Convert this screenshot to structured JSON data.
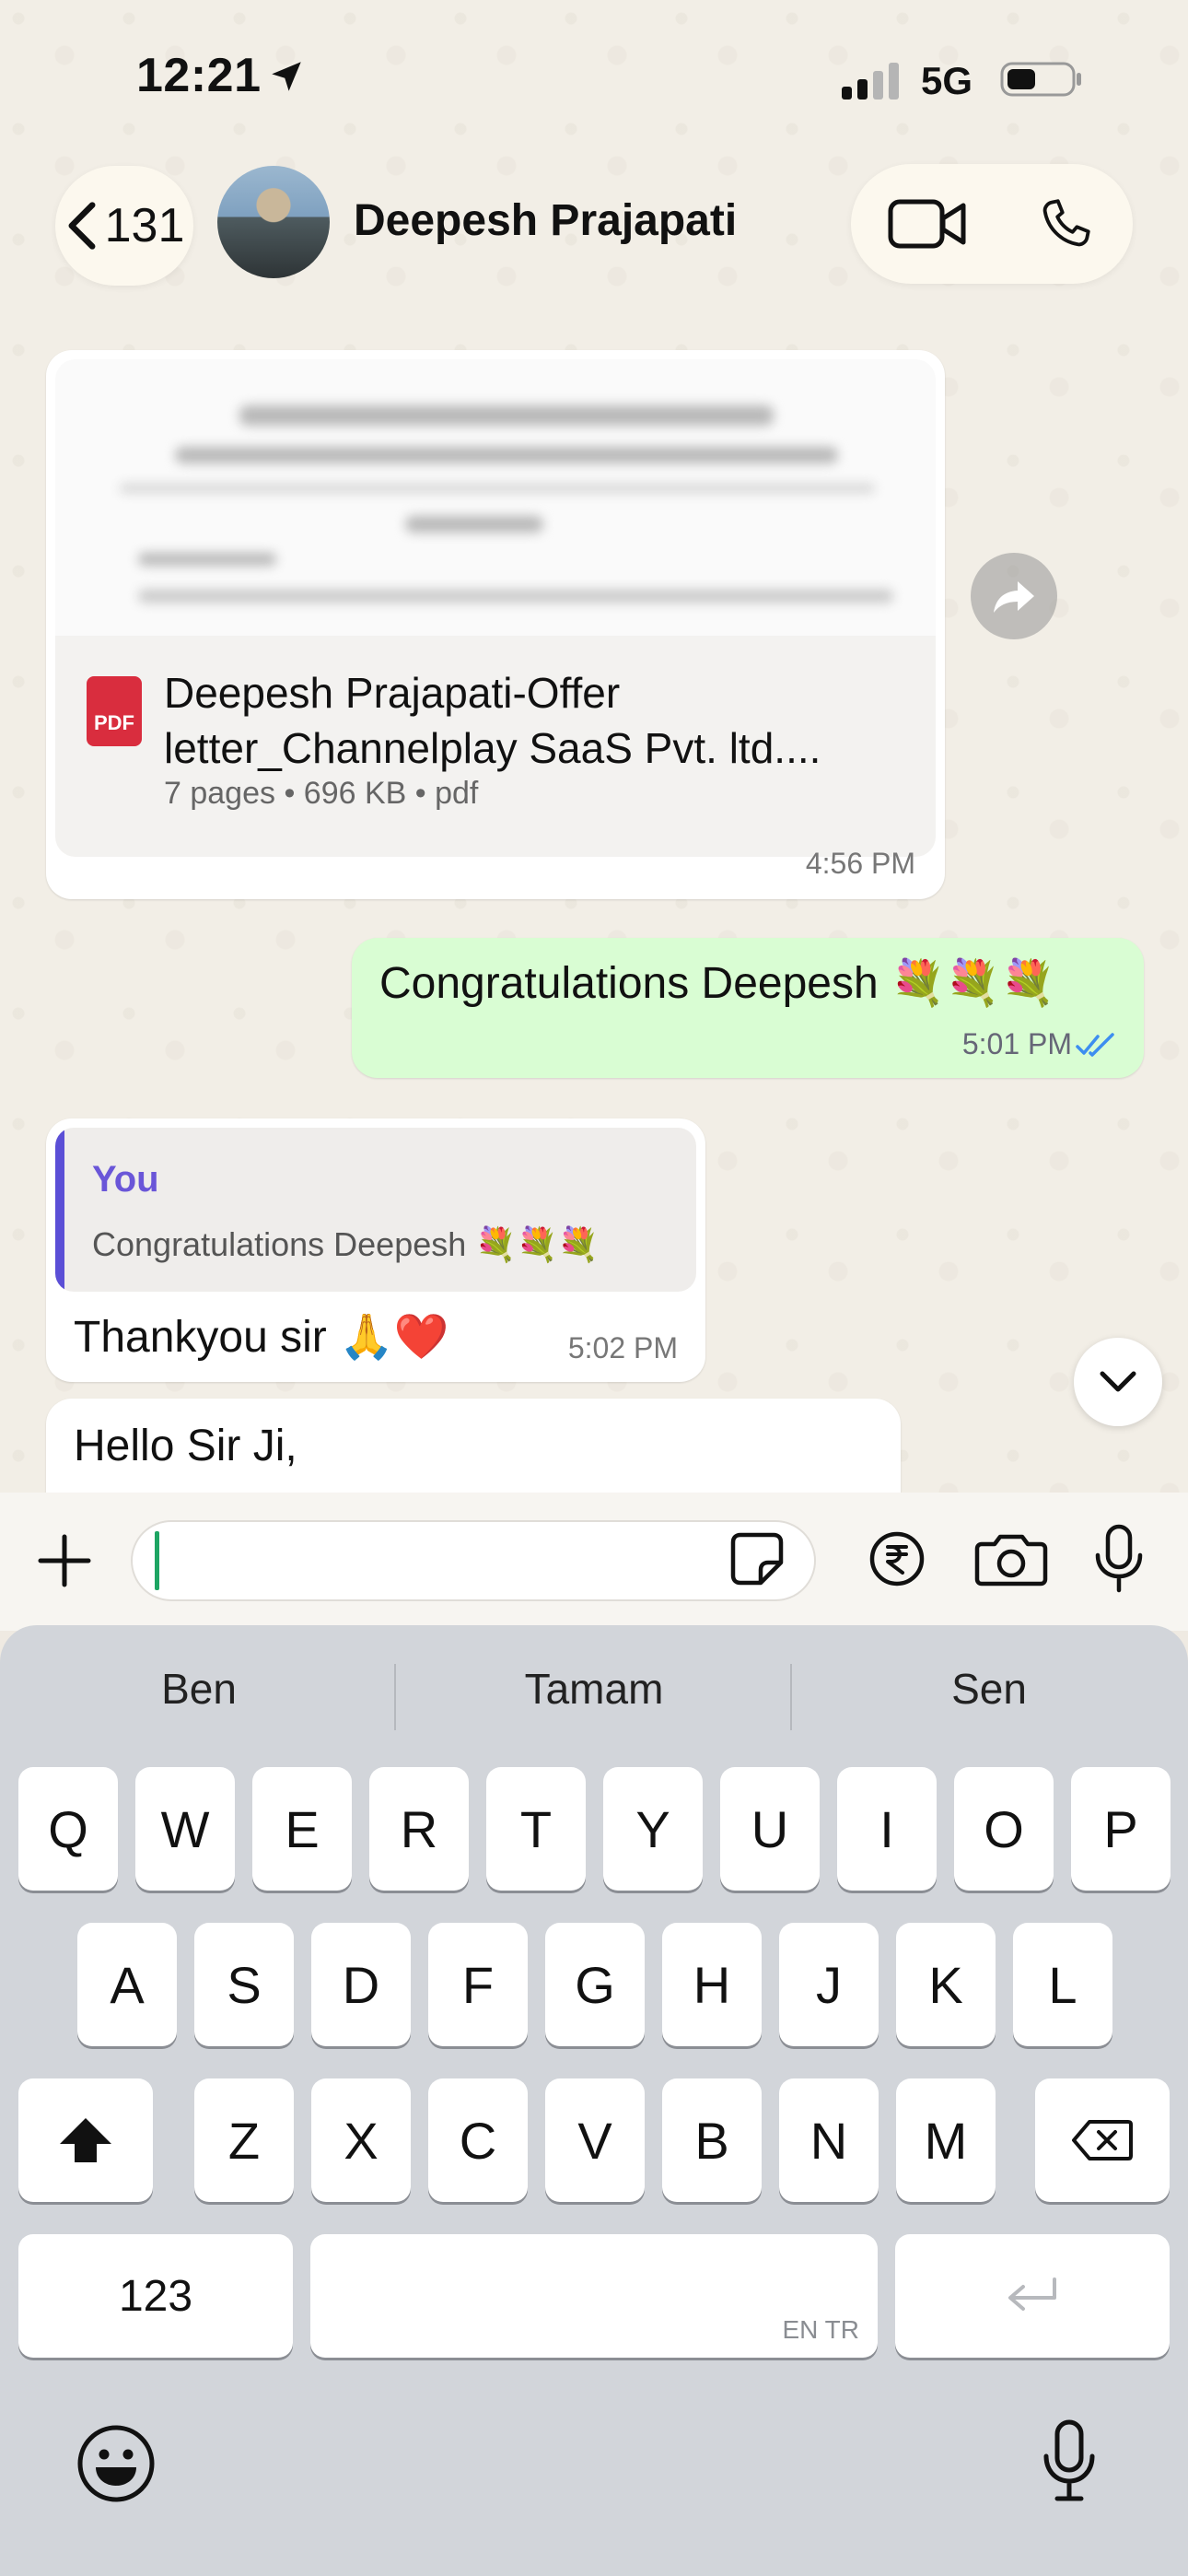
{
  "status_bar": {
    "time": "12:21",
    "network": "5G"
  },
  "header": {
    "back_count": "131",
    "contact_name": "Deepesh Prajapati"
  },
  "messages": {
    "document": {
      "file_name": "Deepesh Prajapati-Offer letter_Channelplay SaaS Pvt. ltd....",
      "meta": "7 pages • 696 KB • pdf",
      "pdf_label": "PDF",
      "time": "4:56 PM"
    },
    "congrats": {
      "text": "Congratulations Deepesh 💐💐💐",
      "time": "5:01 PM"
    },
    "reply": {
      "quote_author": "You",
      "quote_text": "Congratulations Deepesh 💐💐💐",
      "text": "Thankyou sir 🙏❤️",
      "time": "5:02 PM"
    },
    "hello": {
      "text": "Hello Sir Ji,"
    }
  },
  "input": {
    "placeholder": ""
  },
  "keyboard": {
    "suggestions": [
      "Ben",
      "Tamam",
      "Sen"
    ],
    "row1": [
      "Q",
      "W",
      "E",
      "R",
      "T",
      "Y",
      "U",
      "I",
      "O",
      "P"
    ],
    "row2": [
      "A",
      "S",
      "D",
      "F",
      "G",
      "H",
      "J",
      "K",
      "L"
    ],
    "row3": [
      "Z",
      "X",
      "C",
      "V",
      "B",
      "N",
      "M"
    ],
    "numbers_label": "123",
    "space_label": "EN TR"
  },
  "colors": {
    "outgoing_bubble": "#d9fdd3",
    "accent_green": "#1da563",
    "quote_bar": "#5b4fd6",
    "read_ticks": "#3d8ef0",
    "pdf_red": "#d92d3e"
  }
}
